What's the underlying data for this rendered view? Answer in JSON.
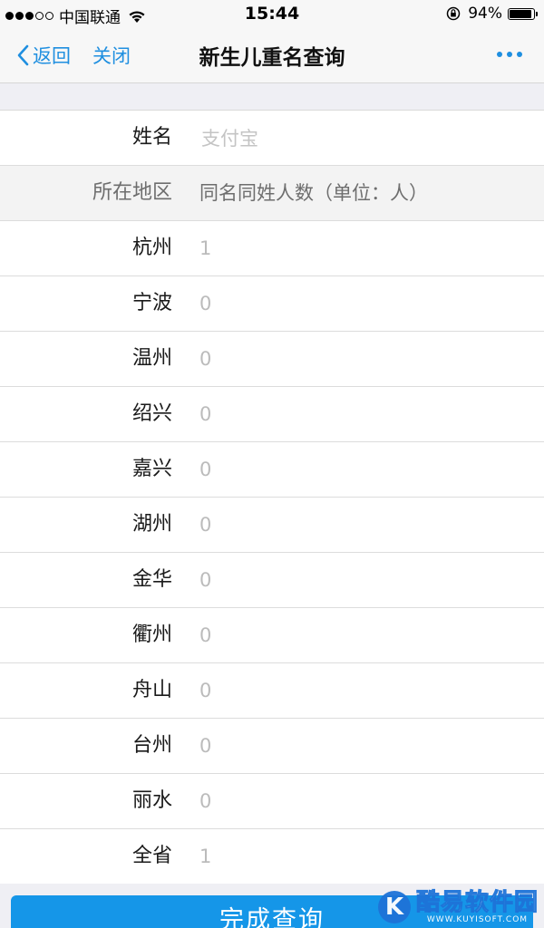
{
  "status_bar": {
    "carrier": "中国联通",
    "time": "15:44",
    "battery": "94%",
    "battery_level": 0.94,
    "signal_bars_on": 3,
    "signal_bars_total": 5
  },
  "nav": {
    "back_label": "返回",
    "close_label": "关闭",
    "title": "新生儿重名查询"
  },
  "form": {
    "name_label": "姓名",
    "name_placeholder": "支付宝",
    "header_region": "所在地区",
    "header_count": "同名同姓人数（单位：人）"
  },
  "regions": [
    {
      "name": "杭州",
      "count": "1"
    },
    {
      "name": "宁波",
      "count": "0"
    },
    {
      "name": "温州",
      "count": "0"
    },
    {
      "name": "绍兴",
      "count": "0"
    },
    {
      "name": "嘉兴",
      "count": "0"
    },
    {
      "name": "湖州",
      "count": "0"
    },
    {
      "name": "金华",
      "count": "0"
    },
    {
      "name": "衢州",
      "count": "0"
    },
    {
      "name": "舟山",
      "count": "0"
    },
    {
      "name": "台州",
      "count": "0"
    },
    {
      "name": "丽水",
      "count": "0"
    },
    {
      "name": "全省",
      "count": "1"
    }
  ],
  "submit_label": "完成查询",
  "watermark": {
    "logo_letter": "K",
    "brand_cn": "酷易软件园",
    "brand_en": "WWW.KUYISOFT.COM"
  },
  "colors": {
    "accent": "#1f8fe0",
    "button": "#1596e8",
    "watermark": "#1e73d8"
  }
}
